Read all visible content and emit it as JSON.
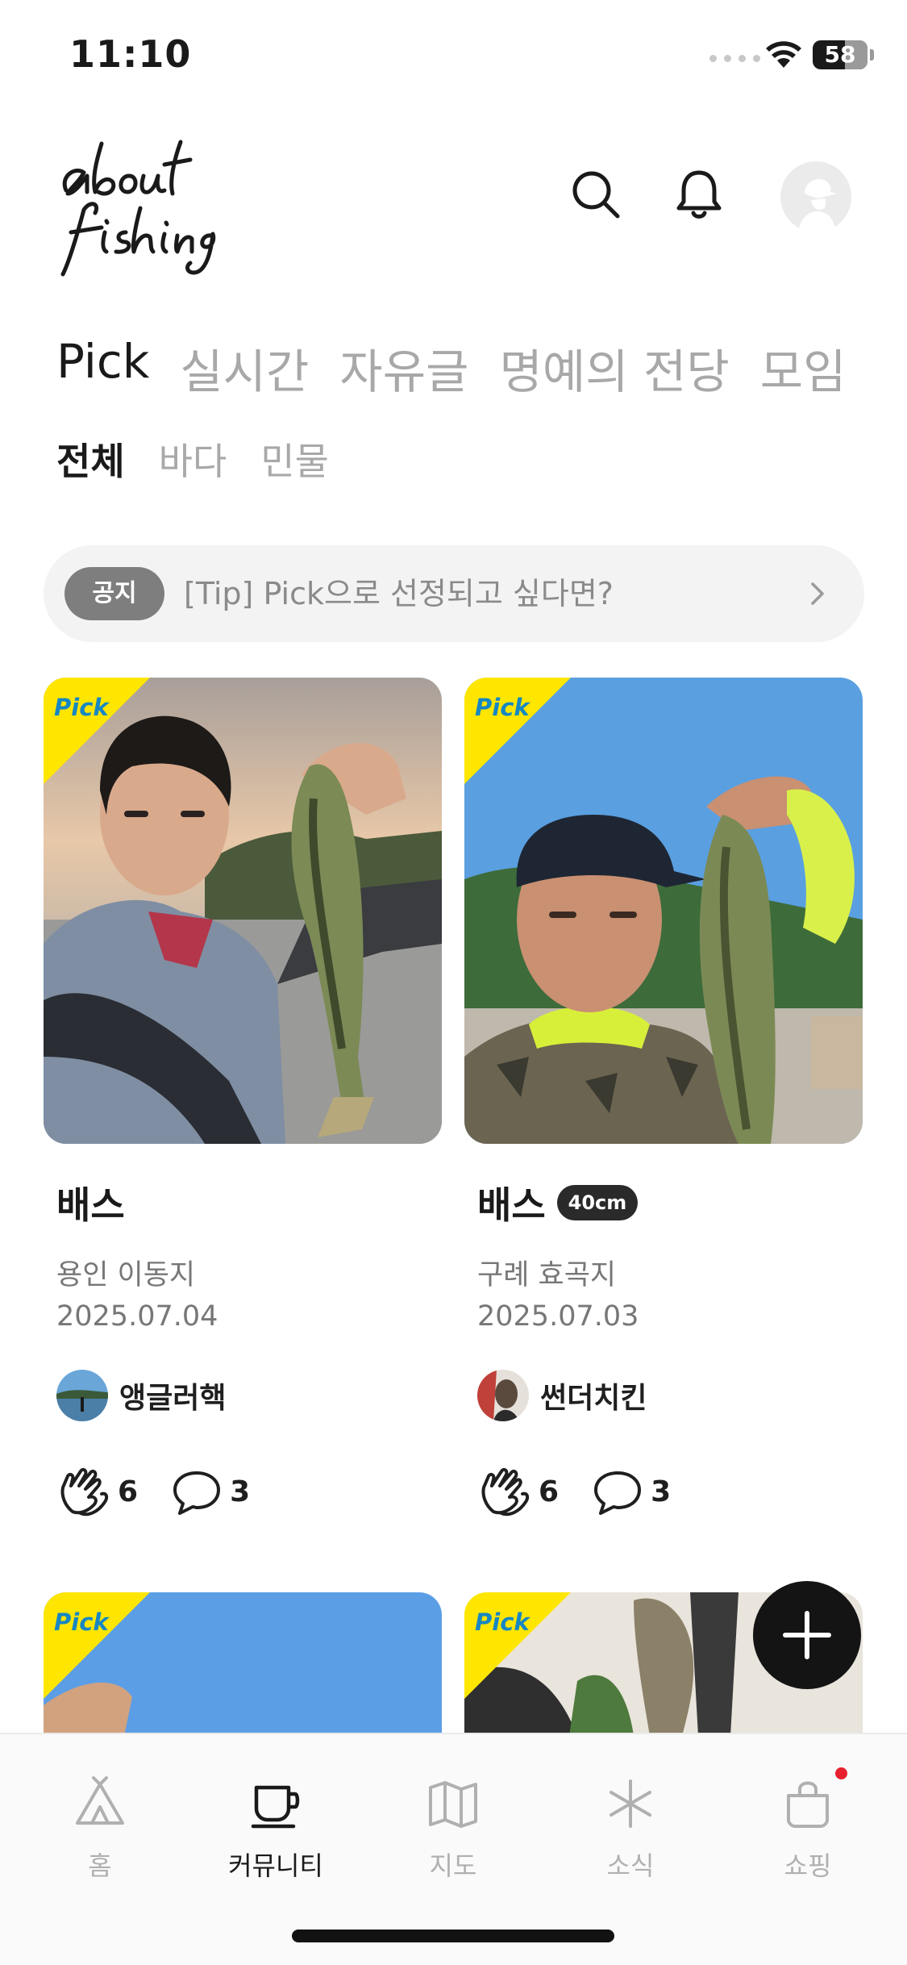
{
  "status_bar": {
    "time": "11:10",
    "battery": "58"
  },
  "header": {
    "logo_text": "about fishing",
    "icons": [
      "search-icon",
      "bell-icon",
      "profile-avatar"
    ]
  },
  "main_tabs": [
    {
      "label": "Pick",
      "active": true
    },
    {
      "label": "실시간",
      "active": false
    },
    {
      "label": "자유글",
      "active": false
    },
    {
      "label": "명예의 전당",
      "active": false
    },
    {
      "label": "모임",
      "active": false
    }
  ],
  "sub_tabs": [
    {
      "label": "전체",
      "active": true
    },
    {
      "label": "바다",
      "active": false
    },
    {
      "label": "민물",
      "active": false
    }
  ],
  "notice": {
    "badge": "공지",
    "text": "[Tip] Pick으로 선정되고 싶다면?"
  },
  "pick_label": "Pick",
  "cards": [
    {
      "species": "배스",
      "size": "",
      "location": "용인 이동지",
      "date": "2025.07.04",
      "user": "앵글러핵",
      "claps": "6",
      "comments": "3"
    },
    {
      "species": "배스",
      "size": "40cm",
      "location": "구례 효곡지",
      "date": "2025.07.03",
      "user": "썬더치킨",
      "claps": "6",
      "comments": "3"
    }
  ],
  "bottom_nav": [
    {
      "label": "홈",
      "icon": "tent-icon",
      "active": false
    },
    {
      "label": "커뮤니티",
      "icon": "cup-icon",
      "active": true
    },
    {
      "label": "지도",
      "icon": "map-icon",
      "active": false
    },
    {
      "label": "소식",
      "icon": "asterisk-icon",
      "active": false
    },
    {
      "label": "쇼핑",
      "icon": "shopping-bag-icon",
      "active": false
    }
  ],
  "colors": {
    "pick_yellow": "#ffe600",
    "pick_text": "#1687c2",
    "fab": "#141414",
    "notification_dot": "#e8202e"
  }
}
